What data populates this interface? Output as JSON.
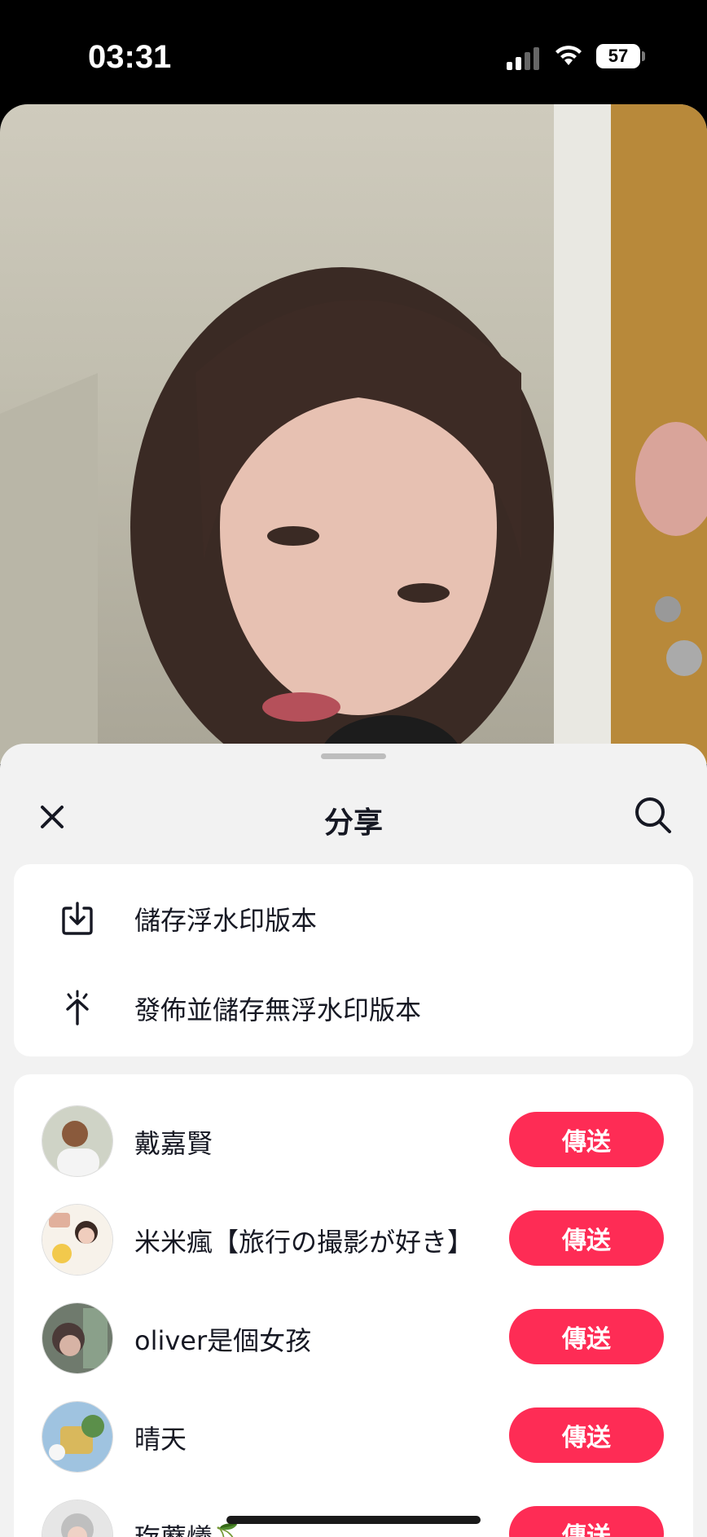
{
  "status_bar": {
    "time": "03:31",
    "battery": "57",
    "icons": [
      "signal-icon",
      "wifi-icon",
      "battery-icon"
    ]
  },
  "sheet": {
    "title": "分享",
    "close_icon": "close-icon",
    "search_icon": "search-icon"
  },
  "save_options": [
    {
      "label": "儲存浮水印版本",
      "icon": "download-icon"
    },
    {
      "label": "發佈並儲存無浮水印版本",
      "icon": "sparkle-arrow-icon"
    }
  ],
  "friends": [
    {
      "name": "戴嘉賢",
      "action": "傳送"
    },
    {
      "name": "米米瘋【旅行の撮影が好き】",
      "action": "傳送"
    },
    {
      "name": "oliver是個女孩",
      "action": "傳送"
    },
    {
      "name": "晴天",
      "action": "傳送"
    },
    {
      "name": "琁蘼爔🍒",
      "action": "傳送"
    }
  ],
  "colors": {
    "accent": "#fe2c55",
    "sheet_background": "#f2f2f2",
    "text": "#161823"
  }
}
